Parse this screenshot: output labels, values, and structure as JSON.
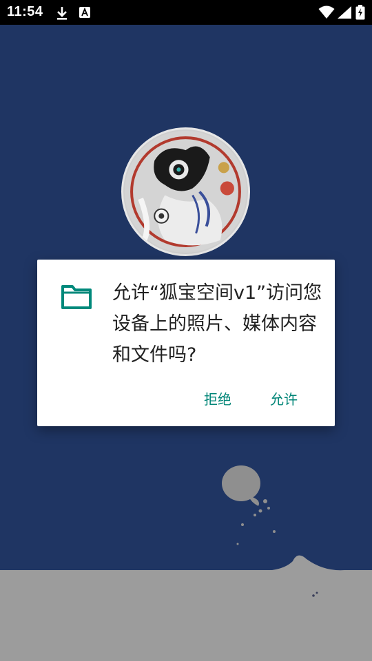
{
  "status_bar": {
    "time": "11:54",
    "icons": [
      "download-icon",
      "a-icon",
      "wifi-icon",
      "signal-icon",
      "battery-icon"
    ]
  },
  "background": {
    "color": "#1f3563",
    "avatar_icon": "avatar-illustration",
    "ground_color": "#9e9e9e"
  },
  "dialog": {
    "icon": "folder-icon",
    "icon_color": "#00897b",
    "message": "允许“狐宝空间v1”访问您设备上的照片、媒体内容和文件吗?",
    "deny_label": "拒绝",
    "allow_label": "允许",
    "accent_color": "#008577"
  }
}
